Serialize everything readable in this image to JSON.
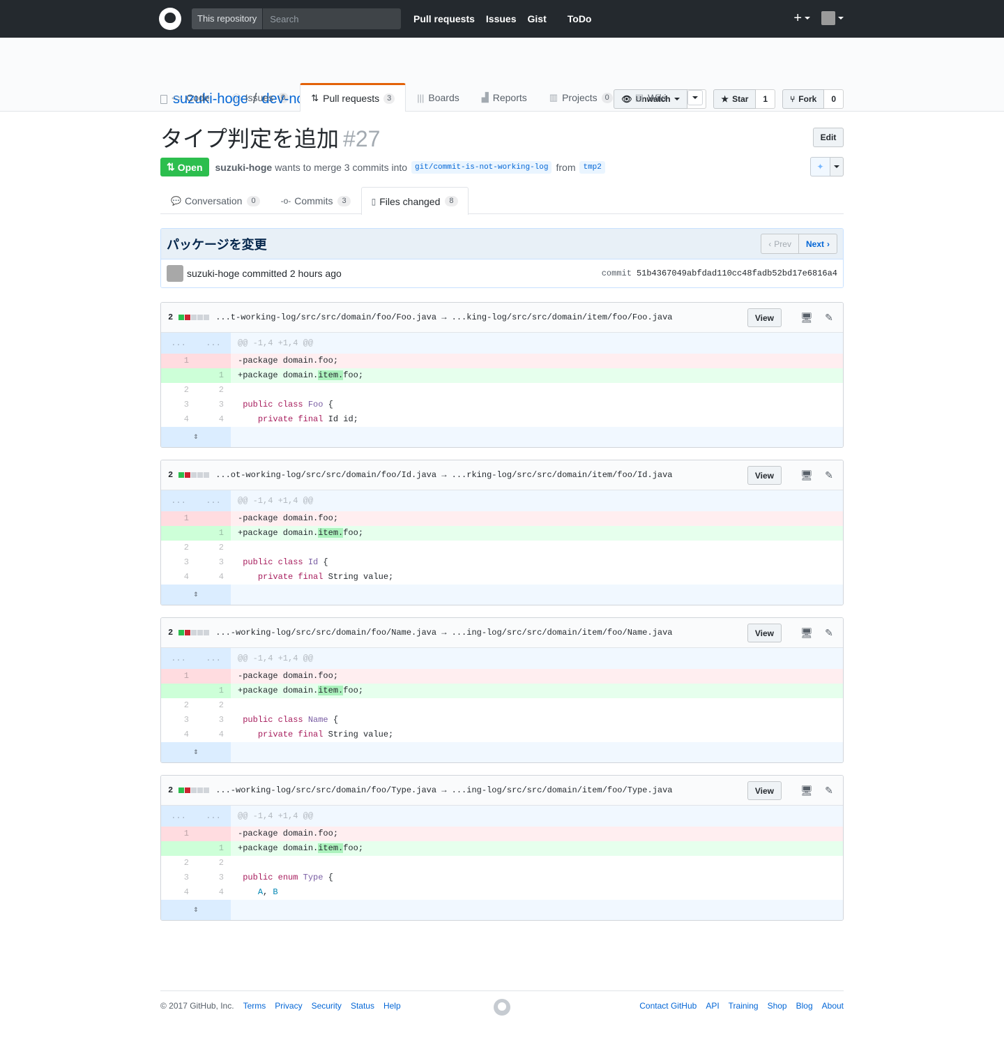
{
  "header": {
    "search_scope": "This repository",
    "search_placeholder": "Search",
    "nav": [
      "Pull requests",
      "Issues",
      "Gist",
      "ToDo"
    ],
    "plus": "+"
  },
  "repo": {
    "owner": "suzuki-hoge",
    "sep": "/",
    "name": "dev-note",
    "actions": {
      "watch_label": "Unwatch",
      "watch_count": "1",
      "star_label": "Star",
      "star_count": "1",
      "fork_label": "Fork",
      "fork_count": "0"
    },
    "tabs": [
      {
        "label": "Code",
        "count": ""
      },
      {
        "label": "Issues",
        "count": "0"
      },
      {
        "label": "Pull requests",
        "count": "3"
      },
      {
        "label": "Boards",
        "count": ""
      },
      {
        "label": "Reports",
        "count": ""
      },
      {
        "label": "Projects",
        "count": "0"
      },
      {
        "label": "Wiki",
        "count": ""
      }
    ]
  },
  "pr": {
    "title": "タイプ判定を追加",
    "number": "#27",
    "edit_label": "Edit",
    "state": "Open",
    "author": "suzuki-hoge",
    "meta_text": "wants to merge 3 commits into",
    "base_branch": "git/commit-is-not-working-log",
    "from_text": "from",
    "head_branch": "tmp2",
    "tabs": [
      {
        "label": "Conversation",
        "count": "0"
      },
      {
        "label": "Commits",
        "count": "3"
      },
      {
        "label": "Files changed",
        "count": "8"
      }
    ]
  },
  "commit": {
    "title": "パッケージを変更",
    "prev_label": "Prev",
    "next_label": "Next",
    "byline": "suzuki-hoge committed 2 hours ago",
    "sha_label": "commit",
    "sha": "51b4367049abfdad110cc48fadb52bd17e6816a4"
  },
  "files": [
    {
      "stat": "2",
      "path": "...t-working-log/src/src/domain/foo/Foo.java → ...king-log/src/src/domain/item/foo/Foo.java",
      "view_label": "View",
      "hunk": "@@ -1,4 +1,4 @@",
      "del": "-package domain.foo;",
      "add_pre": "+package domain.",
      "add_hl": "item.",
      "add_post": "foo;",
      "l3_kw": "public class",
      "l3_name": "Foo",
      "l3_tail": " {",
      "l4": "    private final Id id;"
    },
    {
      "stat": "2",
      "path": "...ot-working-log/src/src/domain/foo/Id.java → ...rking-log/src/src/domain/item/foo/Id.java",
      "view_label": "View",
      "hunk": "@@ -1,4 +1,4 @@",
      "del": "-package domain.foo;",
      "add_pre": "+package domain.",
      "add_hl": "item.",
      "add_post": "foo;",
      "l3_kw": "public class",
      "l3_name": "Id",
      "l3_tail": " {",
      "l4": "    private final String value;"
    },
    {
      "stat": "2",
      "path": "...-working-log/src/src/domain/foo/Name.java → ...ing-log/src/src/domain/item/foo/Name.java",
      "view_label": "View",
      "hunk": "@@ -1,4 +1,4 @@",
      "del": "-package domain.foo;",
      "add_pre": "+package domain.",
      "add_hl": "item.",
      "add_post": "foo;",
      "l3_kw": "public class",
      "l3_name": "Name",
      "l3_tail": " {",
      "l4": "    private final String value;"
    },
    {
      "stat": "2",
      "path": "...-working-log/src/src/domain/foo/Type.java → ...ing-log/src/src/domain/item/foo/Type.java",
      "view_label": "View",
      "hunk": "@@ -1,4 +1,4 @@",
      "del": "-package domain.foo;",
      "add_pre": "+package domain.",
      "add_hl": "item.",
      "add_post": "foo;",
      "l3_kw": "public enum",
      "l3_name": "Type",
      "l3_tail": " {",
      "l4": "    A, B"
    }
  ],
  "line_numbers": {
    "ellipsis": "...",
    "one": "1",
    "two": "2",
    "three": "3",
    "four": "4"
  },
  "footer": {
    "copyright": "© 2017 GitHub, Inc.",
    "left_links": [
      "Terms",
      "Privacy",
      "Security",
      "Status",
      "Help"
    ],
    "right_links": [
      "Contact GitHub",
      "API",
      "Training",
      "Shop",
      "Blog",
      "About"
    ]
  },
  "colors": {
    "header_bg": "#24292e",
    "open_green": "#2cbe4e",
    "link_blue": "#0366d6",
    "tab_accent": "#e36209"
  }
}
